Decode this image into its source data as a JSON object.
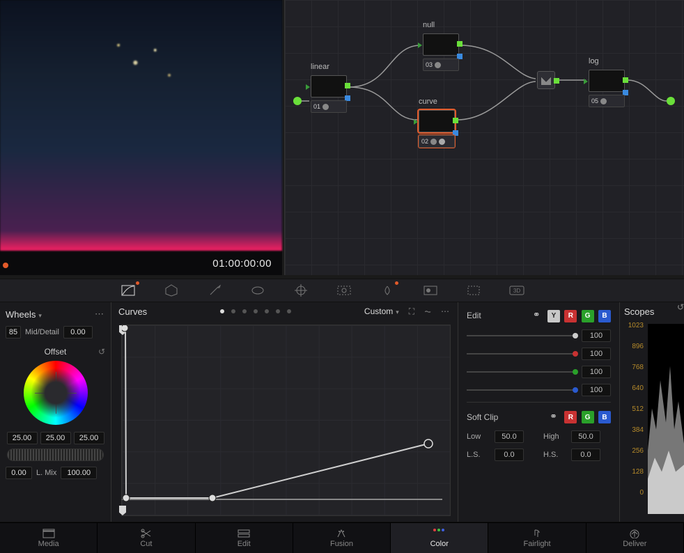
{
  "viewer": {
    "timecode": "01:00:00:00"
  },
  "nodes": {
    "n1": {
      "label": "linear",
      "num": "01"
    },
    "n2": {
      "label": "curve",
      "num": "02"
    },
    "n3": {
      "label": "null",
      "num": "03"
    },
    "n5": {
      "label": "log",
      "num": "05"
    }
  },
  "wheels_panel": {
    "title": "Wheels",
    "hi5_value": "85",
    "mid_detail_label": "Mid/Detail",
    "mid_detail_value": "0.00",
    "wheel_name": "Offset",
    "master_a": "25.00",
    "master_b": "25.00",
    "master_c": "25.00",
    "bottom_a": "0.00",
    "lmix_label": "L. Mix",
    "lmix_value": "100.00"
  },
  "curves_panel": {
    "title": "Curves",
    "mode": "Custom"
  },
  "edit_panel": {
    "edit_label": "Edit",
    "ch_y": "Y",
    "ch_r": "R",
    "ch_g": "G",
    "ch_b": "B",
    "v_lum": "100",
    "v_red": "100",
    "v_green": "100",
    "v_blue": "100",
    "softclip_label": "Soft Clip",
    "low_label": "Low",
    "low_val": "50.0",
    "high_label": "High",
    "high_val": "50.0",
    "ls_label": "L.S.",
    "ls_val": "0.0",
    "hs_label": "H.S.",
    "hs_val": "0.0"
  },
  "scopes": {
    "title": "Scopes",
    "ticks": [
      "1023",
      "896",
      "768",
      "640",
      "512",
      "384",
      "256",
      "128",
      "0"
    ]
  },
  "pages": {
    "media": "Media",
    "cut": "Cut",
    "edit": "Edit",
    "fusion": "Fusion",
    "color": "Color",
    "fairlight": "Fairlight",
    "deliver": "Deliver"
  }
}
